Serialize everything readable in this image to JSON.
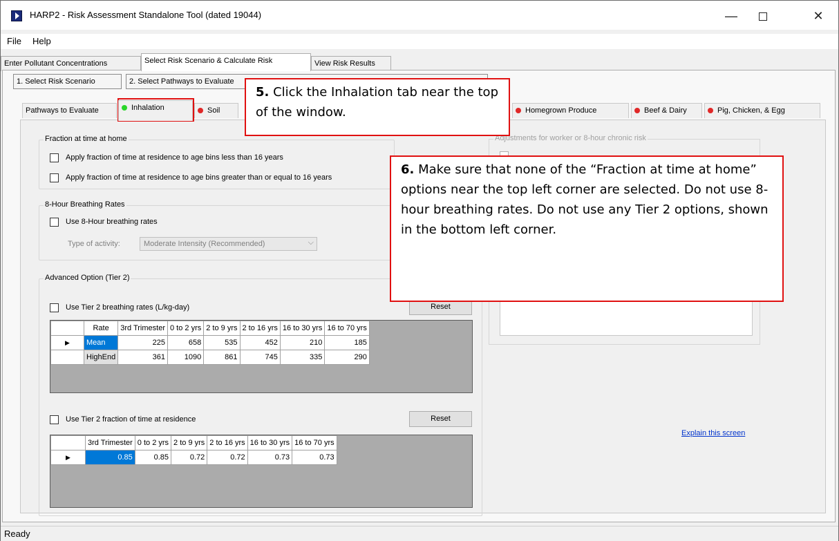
{
  "window": {
    "title": "HARP2 - Risk Assessment Standalone Tool (dated 19044)",
    "min_glyph": "—",
    "close_glyph": "✕"
  },
  "menu": {
    "items": [
      "File",
      "Help"
    ]
  },
  "main_tabs": [
    "Enter Pollutant Concentrations",
    "Select Risk Scenario & Calculate Risk",
    "View Risk Results"
  ],
  "steps": {
    "step1": "1. Select Risk Scenario",
    "step2": "2. Select Pathways to Evaluate"
  },
  "sub_tabs": {
    "pathways": "Pathways to Evaluate",
    "inhalation": "Inhalation",
    "soil": "Soil",
    "homegrown": "Homegrown Produce",
    "beef": "Beef & Dairy",
    "pig": "Pig, Chicken, & Egg"
  },
  "fraction_group": {
    "label": "Fraction at time at home",
    "option1": "Apply fraction of time at residence to age bins less than 16 years",
    "option2": "Apply fraction of time at residence to age bins greater than or equal to 16 years"
  },
  "breathing_group": {
    "label": "8-Hour Breathing Rates",
    "option": "Use 8-Hour breathing rates",
    "activity_label": "Type of activity:",
    "activity_value": "Moderate Intensity (Recommended)"
  },
  "tier2": {
    "label": "Advanced Option (Tier 2)",
    "breathing_option": "Use Tier 2 breathing rates (L/kg-day)",
    "reset_label": "Reset",
    "breathing_headers": [
      "Rate",
      "3rd Trimester",
      "0 to 2 yrs",
      "2 to 9 yrs",
      "2 to 16 yrs",
      "16 to 30 yrs",
      "16 to 70 yrs"
    ],
    "breathing_rows": [
      {
        "rate": "Mean",
        "values": [
          "225",
          "658",
          "535",
          "452",
          "210",
          "185"
        ]
      },
      {
        "rate": "HighEnd",
        "values": [
          "361",
          "1090",
          "861",
          "745",
          "335",
          "290"
        ]
      }
    ],
    "fraction_option": "Use Tier 2 fraction of time at residence",
    "fraction_headers": [
      "3rd Trimester",
      "0 to 2 yrs",
      "2 to 9 yrs",
      "2 to 16 yrs",
      "16 to 30 yrs",
      "16 to 70 yrs"
    ],
    "fraction_values": [
      "0.85",
      "0.85",
      "0.72",
      "0.72",
      "0.73",
      "0.73"
    ]
  },
  "right_panel": {
    "label": "Adjustments for worker or 8-hour chronic risk",
    "explain_link": "Explain this screen"
  },
  "callout5": {
    "number": "5.",
    "text": "Click the Inhalation tab near the top of the window."
  },
  "callout6": {
    "number": "6.",
    "text": "Make sure that none of the “Fraction at time at home” options near the top left corner are selected.  Do not use 8-hour breathing rates.  Do not use any Tier 2 options, shown in the bottom left corner."
  },
  "status": {
    "text": "Ready"
  },
  "colors": {
    "callout_border": "#e01010",
    "active_dot": "#29d629",
    "inactive_dot": "#e02828",
    "selection": "#0078d7"
  }
}
